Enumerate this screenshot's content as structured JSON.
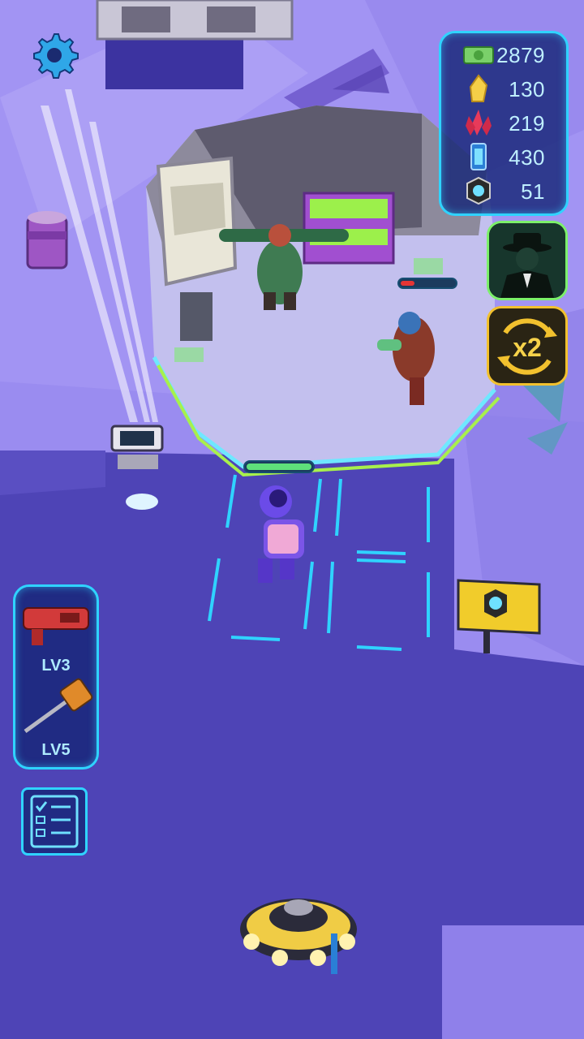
{
  "hud": {
    "resources": [
      {
        "name": "cash",
        "icon": "cash-icon",
        "value": "2879"
      },
      {
        "name": "gold-crystal",
        "icon": "gold-crystal-icon",
        "value": "130"
      },
      {
        "name": "red-crystal",
        "icon": "red-crystal-icon",
        "value": "219"
      },
      {
        "name": "energy-cell",
        "icon": "energy-cell-icon",
        "value": "430"
      },
      {
        "name": "gear-part",
        "icon": "gear-part-icon",
        "value": "51"
      }
    ],
    "weapons": [
      {
        "icon": "blaster-gun-icon",
        "level": "LV3"
      },
      {
        "icon": "hammer-icon",
        "level": "LV5"
      }
    ],
    "buttons": {
      "settings": "settings-icon",
      "agent": "agent-icon",
      "double_reward": "x2-boost-icon",
      "x2_text": "x2",
      "tasks": "task-list-icon"
    }
  },
  "world": {
    "player_health": 1.0,
    "enemy_health": 0.25
  },
  "colors": {
    "accent": "#2fd3ff",
    "panel": "#1a2a78",
    "gold": "#f2c12e",
    "ground": "#4e44b6"
  }
}
